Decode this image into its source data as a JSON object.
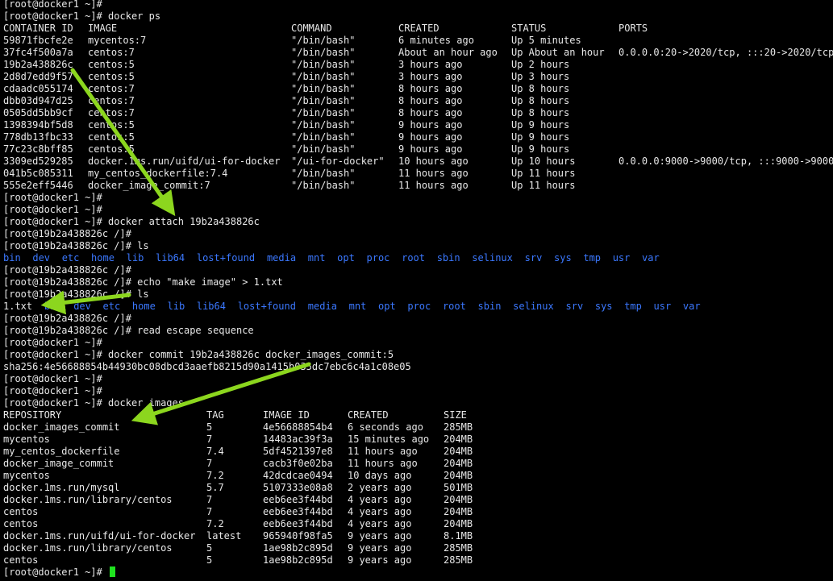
{
  "colors": {
    "background": "#000000",
    "text": "#e8e8e8",
    "directory": "#3b78ff",
    "annotation_arrow": "#8cd61e",
    "cursor": "#1fe21f"
  },
  "lines": [
    {
      "kind": "text",
      "text": "[root@docker1 ~]#"
    },
    {
      "kind": "text",
      "text": "[root@docker1 ~]# docker ps"
    },
    {
      "kind": "row",
      "table": "ps",
      "cells": [
        "CONTAINER ID",
        "IMAGE",
        "COMMAND",
        "CREATED",
        "STATUS",
        "PORTS"
      ]
    },
    {
      "kind": "row",
      "table": "ps",
      "cells": [
        "59871fbcfe2e",
        "mycentos:7",
        "\"/bin/bash\"",
        "6 minutes ago",
        "Up 5 minutes",
        ""
      ]
    },
    {
      "kind": "row",
      "table": "ps",
      "cells": [
        "37fc4f500a7a",
        "centos:7",
        "\"/bin/bash\"",
        "About an hour ago",
        "Up About an hour",
        "0.0.0.0:20->2020/tcp, :::20->2020/tcp"
      ]
    },
    {
      "kind": "row",
      "table": "ps",
      "cells": [
        "19b2a438826c",
        "centos:5",
        "\"/bin/bash\"",
        "3 hours ago",
        "Up 2 hours",
        ""
      ]
    },
    {
      "kind": "row",
      "table": "ps",
      "cells": [
        "2d8d7edd9f57",
        "centos:5",
        "\"/bin/bash\"",
        "3 hours ago",
        "Up 3 hours",
        ""
      ]
    },
    {
      "kind": "row",
      "table": "ps",
      "cells": [
        "cdaadc055174",
        "centos:7",
        "\"/bin/bash\"",
        "8 hours ago",
        "Up 8 hours",
        ""
      ]
    },
    {
      "kind": "row",
      "table": "ps",
      "cells": [
        "dbb03d947d25",
        "centos:7",
        "\"/bin/bash\"",
        "8 hours ago",
        "Up 8 hours",
        ""
      ]
    },
    {
      "kind": "row",
      "table": "ps",
      "cells": [
        "0505dd5bb9cf",
        "centos:7",
        "\"/bin/bash\"",
        "8 hours ago",
        "Up 8 hours",
        ""
      ]
    },
    {
      "kind": "row",
      "table": "ps",
      "cells": [
        "1398394bf5d8",
        "centos:5",
        "\"/bin/bash\"",
        "9 hours ago",
        "Up 9 hours",
        ""
      ]
    },
    {
      "kind": "row",
      "table": "ps",
      "cells": [
        "778db13fbc33",
        "centos:5",
        "\"/bin/bash\"",
        "9 hours ago",
        "Up 9 hours",
        ""
      ]
    },
    {
      "kind": "row",
      "table": "ps",
      "cells": [
        "77c23c8bff85",
        "centos:5",
        "\"/bin/bash\"",
        "9 hours ago",
        "Up 9 hours",
        ""
      ]
    },
    {
      "kind": "row",
      "table": "ps",
      "cells": [
        "3309ed529285",
        "docker.1ms.run/uifd/ui-for-docker",
        "\"/ui-for-docker\"",
        "10 hours ago",
        "Up 10 hours",
        "0.0.0.0:9000->9000/tcp, :::9000->9000/"
      ]
    },
    {
      "kind": "row",
      "table": "ps",
      "cells": [
        "041b5c085311",
        "my_centos_dockerfile:7.4",
        "\"/bin/bash\"",
        "11 hours ago",
        "Up 11 hours",
        ""
      ]
    },
    {
      "kind": "row",
      "table": "ps",
      "cells": [
        "555e2eff5446",
        "docker_image_commit:7",
        "\"/bin/bash\"",
        "11 hours ago",
        "Up 11 hours",
        ""
      ]
    },
    {
      "kind": "text",
      "text": "[root@docker1 ~]#"
    },
    {
      "kind": "text",
      "text": "[root@docker1 ~]#"
    },
    {
      "kind": "text",
      "text": "[root@docker1 ~]# docker attach 19b2a438826c"
    },
    {
      "kind": "text",
      "text": "[root@19b2a438826c /]#"
    },
    {
      "kind": "text",
      "text": "[root@19b2a438826c /]# ls"
    },
    {
      "kind": "ls",
      "items": [
        {
          "name": "bin",
          "type": "dir"
        },
        {
          "name": "dev",
          "type": "dir"
        },
        {
          "name": "etc",
          "type": "dir"
        },
        {
          "name": "home",
          "type": "dir"
        },
        {
          "name": "lib",
          "type": "dir"
        },
        {
          "name": "lib64",
          "type": "dir"
        },
        {
          "name": "lost+found",
          "type": "dir"
        },
        {
          "name": "media",
          "type": "dir"
        },
        {
          "name": "mnt",
          "type": "dir"
        },
        {
          "name": "opt",
          "type": "dir"
        },
        {
          "name": "proc",
          "type": "dir"
        },
        {
          "name": "root",
          "type": "dir"
        },
        {
          "name": "sbin",
          "type": "dir"
        },
        {
          "name": "selinux",
          "type": "dir"
        },
        {
          "name": "srv",
          "type": "dir"
        },
        {
          "name": "sys",
          "type": "dir"
        },
        {
          "name": "tmp",
          "type": "dir"
        },
        {
          "name": "usr",
          "type": "dir"
        },
        {
          "name": "var",
          "type": "dir"
        }
      ]
    },
    {
      "kind": "text",
      "text": "[root@19b2a438826c /]#"
    },
    {
      "kind": "text",
      "text": "[root@19b2a438826c /]# echo \"make image\" > 1.txt"
    },
    {
      "kind": "text",
      "text": "[root@19b2a438826c /]# ls"
    },
    {
      "kind": "ls",
      "items": [
        {
          "name": "1.txt",
          "type": "file"
        },
        {
          "name": "bin",
          "type": "dir"
        },
        {
          "name": "dev",
          "type": "dir"
        },
        {
          "name": "etc",
          "type": "dir"
        },
        {
          "name": "home",
          "type": "dir"
        },
        {
          "name": "lib",
          "type": "dir"
        },
        {
          "name": "lib64",
          "type": "dir"
        },
        {
          "name": "lost+found",
          "type": "dir"
        },
        {
          "name": "media",
          "type": "dir"
        },
        {
          "name": "mnt",
          "type": "dir"
        },
        {
          "name": "opt",
          "type": "dir"
        },
        {
          "name": "proc",
          "type": "dir"
        },
        {
          "name": "root",
          "type": "dir"
        },
        {
          "name": "sbin",
          "type": "dir"
        },
        {
          "name": "selinux",
          "type": "dir"
        },
        {
          "name": "srv",
          "type": "dir"
        },
        {
          "name": "sys",
          "type": "dir"
        },
        {
          "name": "tmp",
          "type": "dir"
        },
        {
          "name": "usr",
          "type": "dir"
        },
        {
          "name": "var",
          "type": "dir"
        }
      ]
    },
    {
      "kind": "text",
      "text": "[root@19b2a438826c /]#"
    },
    {
      "kind": "text",
      "text": "[root@19b2a438826c /]# read escape sequence"
    },
    {
      "kind": "text",
      "text": "[root@docker1 ~]#"
    },
    {
      "kind": "text",
      "text": "[root@docker1 ~]# docker commit 19b2a438826c docker_images_commit:5"
    },
    {
      "kind": "text",
      "text": "sha256:4e56688854b44930bc08dbcd3aaefb8215d90a1415b035dc7ebc6c4a1c08e05"
    },
    {
      "kind": "text",
      "text": "[root@docker1 ~]#"
    },
    {
      "kind": "text",
      "text": "[root@docker1 ~]#"
    },
    {
      "kind": "text",
      "text": "[root@docker1 ~]# docker images"
    },
    {
      "kind": "row",
      "table": "images",
      "cells": [
        "REPOSITORY",
        "TAG",
        "IMAGE ID",
        "CREATED",
        "SIZE"
      ]
    },
    {
      "kind": "row",
      "table": "images",
      "cells": [
        "docker_images_commit",
        "5",
        "4e56688854b4",
        "6 seconds ago",
        "285MB"
      ]
    },
    {
      "kind": "row",
      "table": "images",
      "cells": [
        "mycentos",
        "7",
        "14483ac39f3a",
        "15 minutes ago",
        "204MB"
      ]
    },
    {
      "kind": "row",
      "table": "images",
      "cells": [
        "my_centos_dockerfile",
        "7.4",
        "5df4521397e8",
        "11 hours ago",
        "204MB"
      ]
    },
    {
      "kind": "row",
      "table": "images",
      "cells": [
        "docker_image_commit",
        "7",
        "cacb3f0e02ba",
        "11 hours ago",
        "204MB"
      ]
    },
    {
      "kind": "row",
      "table": "images",
      "cells": [
        "mycentos",
        "7.2",
        "42dcdcae0494",
        "10 days ago",
        "204MB"
      ]
    },
    {
      "kind": "row",
      "table": "images",
      "cells": [
        "docker.1ms.run/mysql",
        "5.7",
        "5107333e08a8",
        "2 years ago",
        "501MB"
      ]
    },
    {
      "kind": "row",
      "table": "images",
      "cells": [
        "docker.1ms.run/library/centos",
        "7",
        "eeb6ee3f44bd",
        "4 years ago",
        "204MB"
      ]
    },
    {
      "kind": "row",
      "table": "images",
      "cells": [
        "centos",
        "7",
        "eeb6ee3f44bd",
        "4 years ago",
        "204MB"
      ]
    },
    {
      "kind": "row",
      "table": "images",
      "cells": [
        "centos",
        "7.2",
        "eeb6ee3f44bd",
        "4 years ago",
        "204MB"
      ]
    },
    {
      "kind": "row",
      "table": "images",
      "cells": [
        "docker.1ms.run/uifd/ui-for-docker",
        "latest",
        "965940f98fa5",
        "9 years ago",
        "8.1MB"
      ]
    },
    {
      "kind": "row",
      "table": "images",
      "cells": [
        "docker.1ms.run/library/centos",
        "5",
        "1ae98b2c895d",
        "9 years ago",
        "285MB"
      ]
    },
    {
      "kind": "row",
      "table": "images",
      "cells": [
        "centos",
        "5",
        "1ae98b2c895d",
        "9 years ago",
        "285MB"
      ]
    },
    {
      "kind": "prompt",
      "text": "[root@docker1 ~]# "
    }
  ]
}
